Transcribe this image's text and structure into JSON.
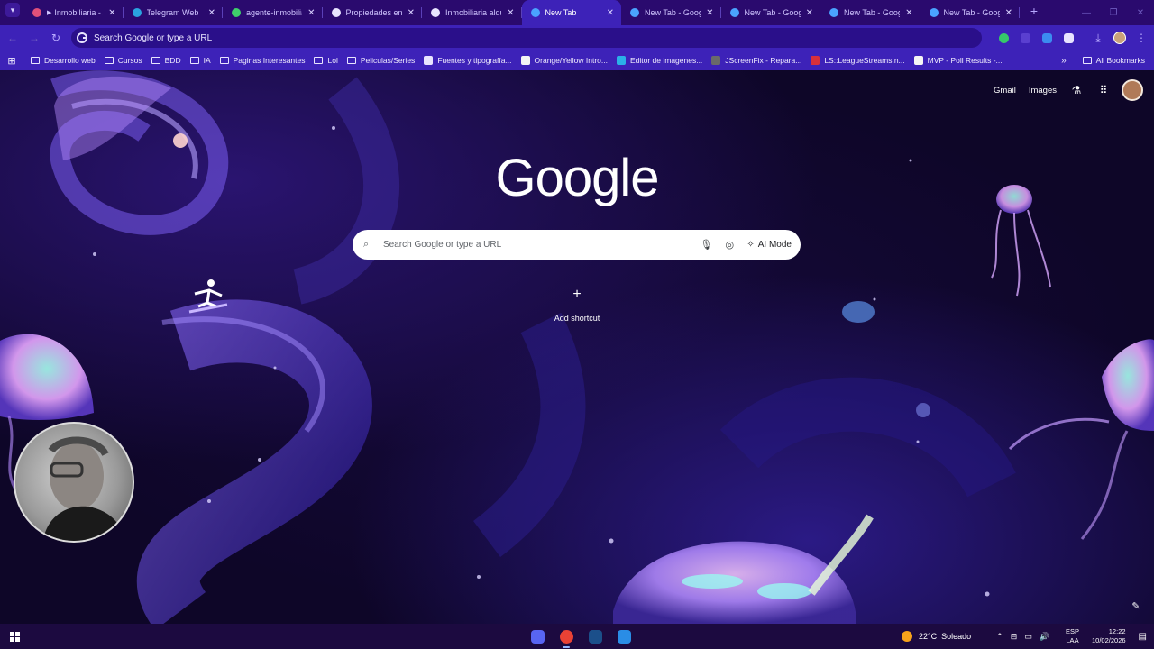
{
  "browser": {
    "tabs": [
      {
        "title": "Inmobiliaria - A",
        "favicon_color": "#e0507a",
        "playing": true,
        "active": false
      },
      {
        "title": "Telegram Web",
        "favicon_color": "#2aa3e0",
        "active": false
      },
      {
        "title": "agente-inmobilia",
        "favicon_color": "#3fcf6b",
        "active": false
      },
      {
        "title": "Propiedades en a",
        "favicon_color": "#e8e4ff",
        "active": false
      },
      {
        "title": "Inmobiliaria alqu",
        "favicon_color": "#e8e4ff",
        "active": false
      },
      {
        "title": "New Tab",
        "favicon_color": "#4aa3ff",
        "active": true
      },
      {
        "title": "New Tab - Googl",
        "favicon_color": "#4aa3ff",
        "active": false
      },
      {
        "title": "New Tab - Googl",
        "favicon_color": "#4aa3ff",
        "active": false
      },
      {
        "title": "New Tab - Googl",
        "favicon_color": "#4aa3ff",
        "active": false
      },
      {
        "title": "New Tab - Googl",
        "favicon_color": "#4aa3ff",
        "active": false
      }
    ],
    "omnibox_placeholder": "Search Google or type a URL",
    "extensions": [
      {
        "icon": "extension-green-circle-icon",
        "color": "#36c76a"
      },
      {
        "icon": "extension-purple-icon",
        "color": "#5a3fd0"
      },
      {
        "icon": "extension-blue-icon",
        "color": "#3b8cf0"
      },
      {
        "icon": "puzzle-icon",
        "color": "#e8e4ff"
      }
    ]
  },
  "bookmarks": {
    "items": [
      {
        "label": "Desarrollo web",
        "type": "folder"
      },
      {
        "label": "Cursos",
        "type": "folder"
      },
      {
        "label": "BDD",
        "type": "folder"
      },
      {
        "label": "IA",
        "type": "folder"
      },
      {
        "label": "Paginas Interesantes",
        "type": "folder"
      },
      {
        "label": "Lol",
        "type": "folder"
      },
      {
        "label": "Peliculas/Series",
        "type": "folder"
      },
      {
        "label": "Fuentes y tipografía...",
        "type": "link",
        "color": "#e8e4ff"
      },
      {
        "label": "Orange/Yellow Intro...",
        "type": "link",
        "color": "#f4f4f4"
      },
      {
        "label": "Editor de imagenes...",
        "type": "link",
        "color": "#2bb0e8"
      },
      {
        "label": "JScreenFix - Repara...",
        "type": "link",
        "color": "#6a6a6a"
      },
      {
        "label": "LS::LeagueStreams.n...",
        "type": "link",
        "color": "#d8303a"
      },
      {
        "label": "MVP - Poll Results -...",
        "type": "link",
        "color": "#f5f5f5"
      }
    ],
    "all_label": "All Bookmarks"
  },
  "ntp": {
    "links": {
      "gmail": "Gmail",
      "images": "Images"
    },
    "logo": "Google",
    "search_placeholder": "Search Google or type a URL",
    "ai_mode_label": "AI Mode",
    "add_shortcut_label": "Add shortcut"
  },
  "taskbar": {
    "weather_temp": "22°C",
    "weather_desc": "Soleado",
    "lang_1": "ESP",
    "lang_2": "LAA",
    "time": "12:22",
    "date": "10/02/2026",
    "apps": [
      {
        "name": "discord-icon",
        "color": "#5865f2"
      },
      {
        "name": "chrome-icon",
        "color": "#e94235"
      },
      {
        "name": "steam-icon",
        "color": "#1b4f8a"
      },
      {
        "name": "vscode-icon",
        "color": "#2a8de6"
      }
    ]
  }
}
